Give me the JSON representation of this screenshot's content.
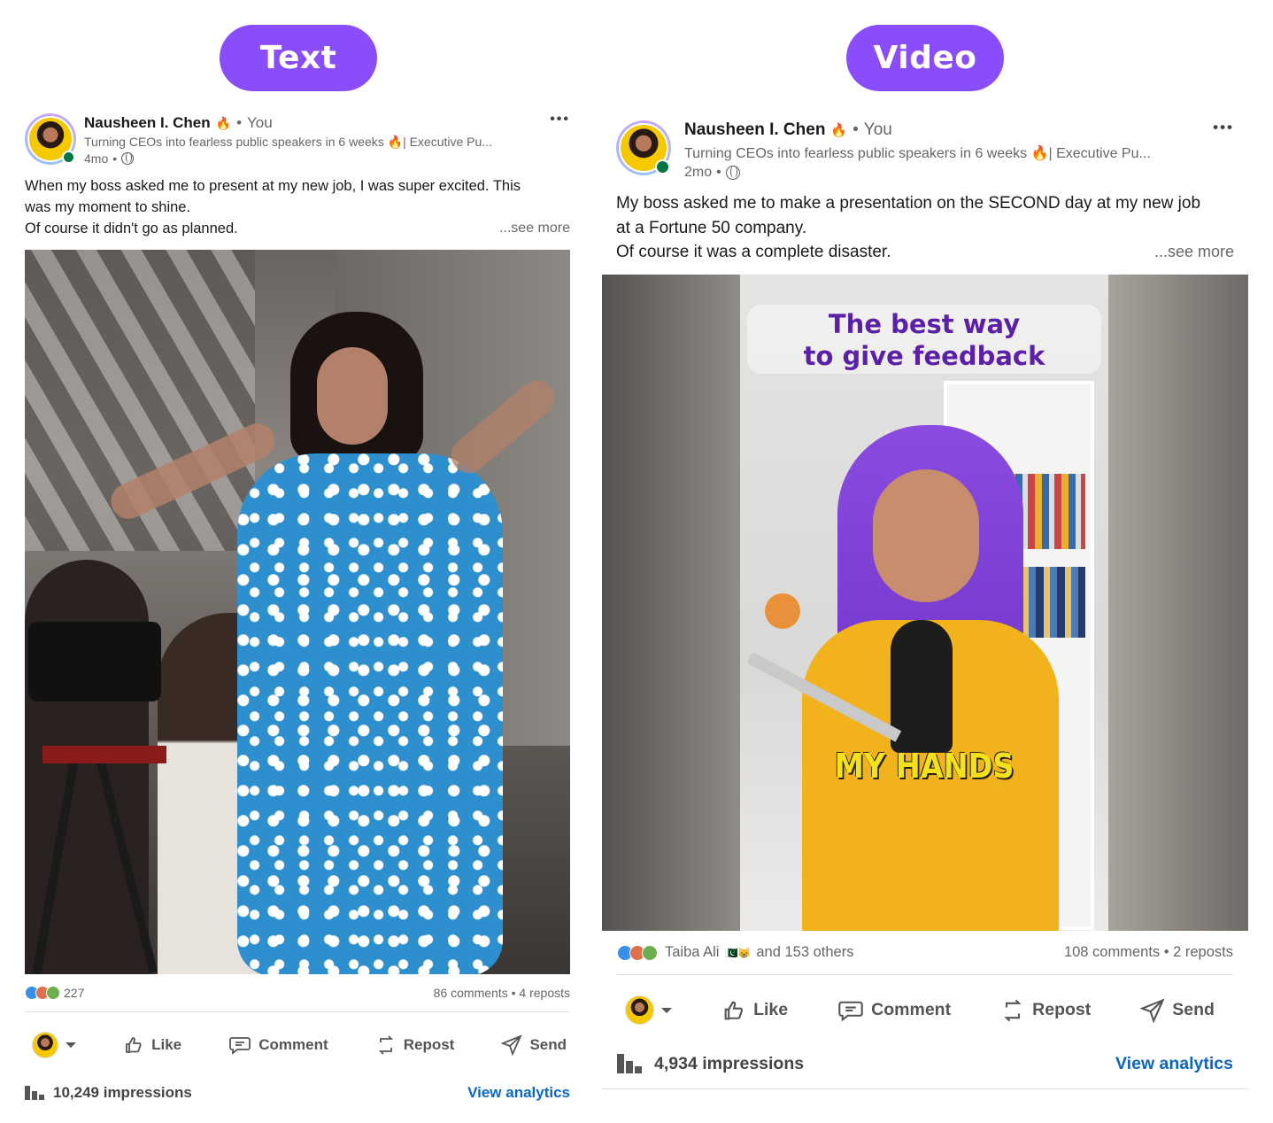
{
  "labels": {
    "left": "Text",
    "right": "Video"
  },
  "left_post": {
    "author": "Nausheen I. Chen",
    "author_flame": "🔥",
    "you_label": "You",
    "tagline": "Turning CEOs into fearless public speakers in 6 weeks 🔥| Executive Pu...",
    "age": "4mo",
    "more": "•••",
    "text_line1": "When my boss asked me to present at my new job, I was super excited. This",
    "text_line2": "was my moment to shine.",
    "text_line3": "Of course it didn't go as planned.",
    "see_more": "...see more",
    "reaction_count": "227",
    "comments": "86 comments",
    "reposts": "4 reposts",
    "actions": {
      "like": "Like",
      "comment": "Comment",
      "repost": "Repost",
      "send": "Send"
    },
    "impressions": "10,249 impressions",
    "view_analytics": "View analytics"
  },
  "right_post": {
    "author": "Nausheen I. Chen",
    "author_flame": "🔥",
    "you_label": "You",
    "tagline": "Turning CEOs into fearless public speakers in 6 weeks 🔥| Executive Pu...",
    "age": "2mo",
    "more": "•••",
    "text_line1": "My boss asked me to make a presentation on the SECOND day at my new job",
    "text_line2": "at a Fortune 50 company.",
    "text_line3": "Of course it was a complete disaster.",
    "see_more": "...see more",
    "video_caption_top1": "The best way",
    "video_caption_top2": "to give feedback",
    "video_caption_bottom": "MY HANDS",
    "reactor_name": "Taiba Ali",
    "reactor_flags": "🇵🇰😸",
    "reactor_others": "and 153 others",
    "comments": "108 comments",
    "reposts": "2 reposts",
    "actions": {
      "like": "Like",
      "comment": "Comment",
      "repost": "Repost",
      "send": "Send"
    },
    "impressions": "4,934 impressions",
    "view_analytics": "View analytics"
  },
  "colors": {
    "pill": "#8a4dfc",
    "link": "#0a66c2",
    "online": "#057642",
    "caption_purple": "#5b1fa8",
    "caption_yellow": "#f5e11a"
  }
}
